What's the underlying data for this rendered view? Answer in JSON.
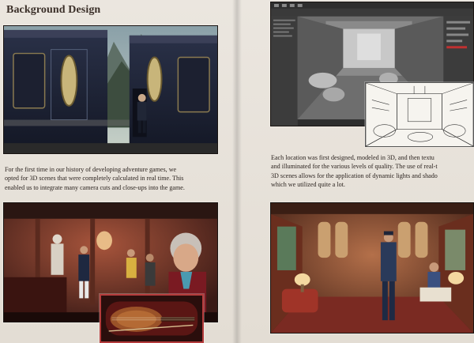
{
  "left_page": {
    "heading": "Background Design",
    "paragraph_lines": [
      "For the first time in our history of developing adventure games, we",
      "opted for 3D scenes that were completely calculated in real time. This",
      "enabled us to integrate many camera cuts and close-ups into the game."
    ]
  },
  "right_page": {
    "paragraph_lines": [
      "Each location was first designed, modeled in 3D, and then textu",
      "and illuminated for the various levels of quality. The use of real-t",
      "3D scenes allows for the application of dynamic lights and shado",
      "which we utilized quite a lot."
    ]
  },
  "colors": {
    "paper": "#e6e0d8",
    "text": "#2c2420",
    "heading": "#3a2f28",
    "highlight_border": "#b53c3c"
  }
}
